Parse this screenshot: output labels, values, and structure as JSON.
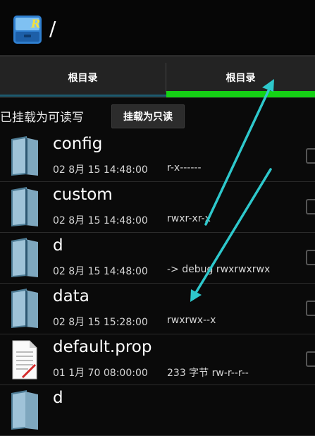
{
  "header": {
    "path": "/"
  },
  "tabs": [
    {
      "label": "根目录"
    },
    {
      "label": "根目录"
    }
  ],
  "mount": {
    "status": "已挂载为可读写",
    "button": "挂载为只读"
  },
  "files": [
    {
      "name": "config",
      "date": "02 8月 15 14:48:00",
      "info": "r-x------",
      "icon": "folder-icon"
    },
    {
      "name": "custom",
      "date": "02 8月 15 14:48:00",
      "info": "rwxr-xr-x",
      "icon": "folder-icon"
    },
    {
      "name": "d",
      "date": "02 8月 15 14:48:00",
      "info": "-> debug  rwxrwxrwx",
      "icon": "folder-icon"
    },
    {
      "name": "data",
      "date": "02 8月 15 15:28:00",
      "info": "rwxrwx--x",
      "icon": "folder-icon"
    },
    {
      "name": "default.prop",
      "date": "01 1月 70 08:00:00",
      "info": "233 字节   rw-r--r--",
      "icon": "document-icon"
    },
    {
      "name": "d",
      "date": "",
      "info": "",
      "icon": "folder-icon"
    }
  ],
  "colors": {
    "tab_active": "#15d115",
    "annotation_arrow": "#2ec8cc",
    "background": "#0a0a0a"
  }
}
